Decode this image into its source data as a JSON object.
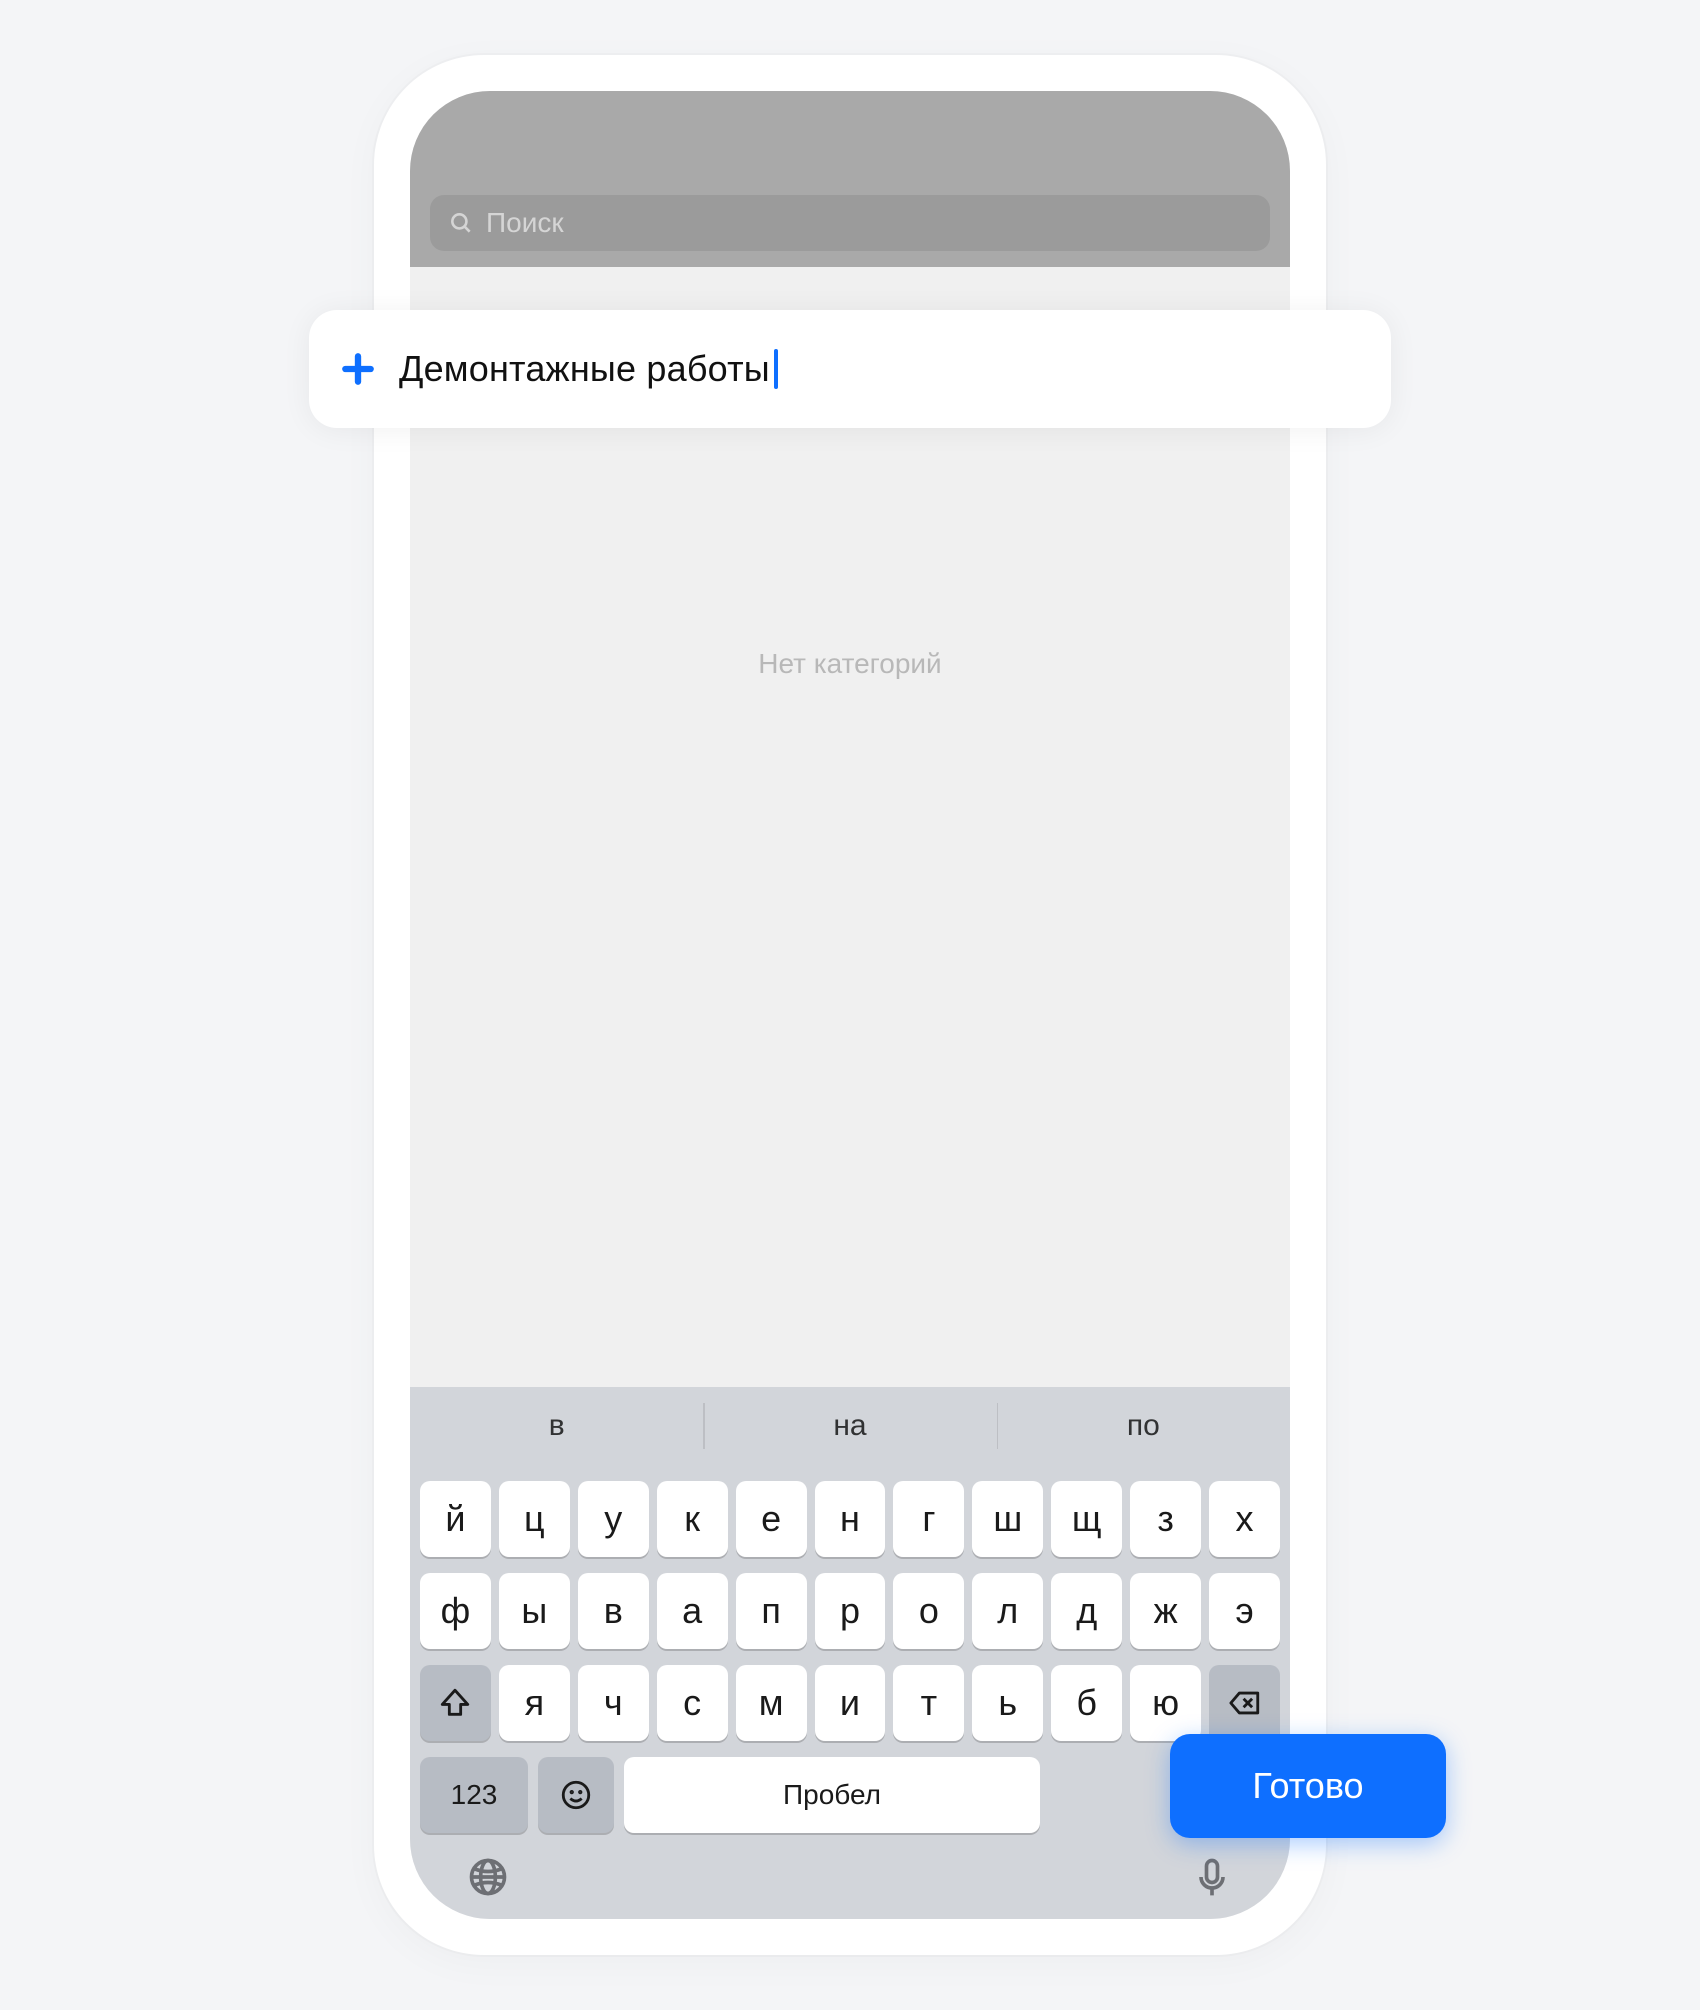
{
  "search": {
    "placeholder": "Поиск"
  },
  "addRow": {
    "text": "Демонтажные работы"
  },
  "emptyState": {
    "label": "Нет категорий"
  },
  "keyboard": {
    "suggestions": [
      "в",
      "на",
      "по"
    ],
    "row1": [
      "й",
      "ц",
      "у",
      "к",
      "е",
      "н",
      "г",
      "ш",
      "щ",
      "з",
      "х"
    ],
    "row2": [
      "ф",
      "ы",
      "в",
      "а",
      "п",
      "р",
      "о",
      "л",
      "д",
      "ж",
      "э"
    ],
    "row3": [
      "я",
      "ч",
      "с",
      "м",
      "и",
      "т",
      "ь",
      "б",
      "ю"
    ],
    "numericKey": "123",
    "spaceKey": "Пробел",
    "doneKey": "Готово"
  }
}
